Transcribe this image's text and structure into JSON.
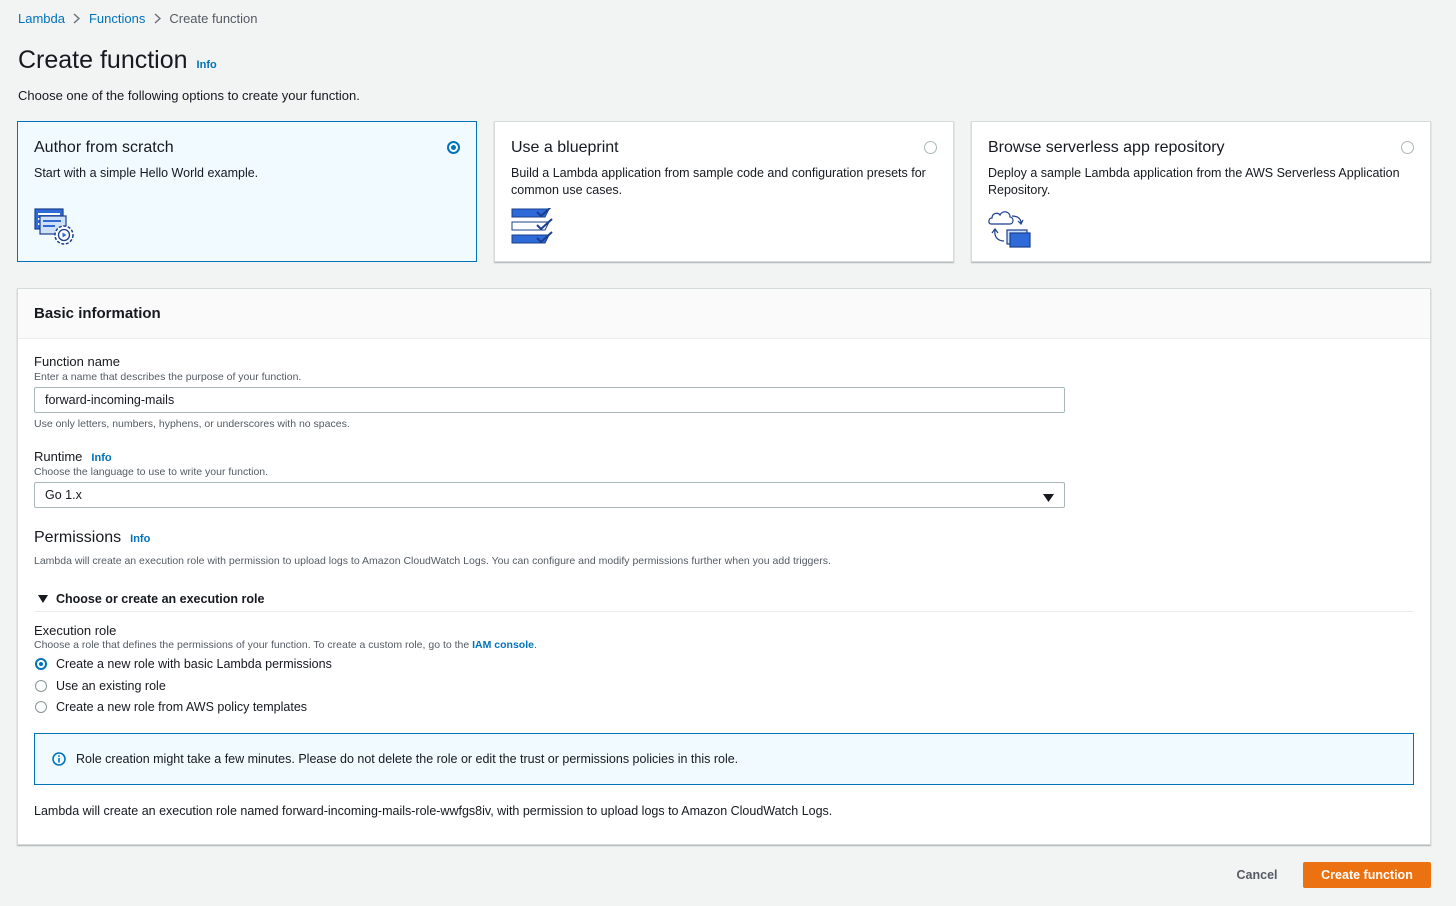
{
  "breadcrumb": {
    "items": [
      {
        "label": "Lambda"
      },
      {
        "label": "Functions"
      },
      {
        "label": "Create function"
      }
    ]
  },
  "header": {
    "title": "Create function",
    "info_label": "Info",
    "description": "Choose one of the following options to create your function."
  },
  "options": [
    {
      "title": "Author from scratch",
      "description": "Start with a simple Hello World example.",
      "selected": true
    },
    {
      "title": "Use a blueprint",
      "description": "Build a Lambda application from sample code and configuration presets for common use cases.",
      "selected": false
    },
    {
      "title": "Browse serverless app repository",
      "description": "Deploy a sample Lambda application from the AWS Serverless Application Repository.",
      "selected": false
    }
  ],
  "basic_info": {
    "title": "Basic information",
    "function_name": {
      "label": "Function name",
      "description": "Enter a name that describes the purpose of your function.",
      "value": "forward-incoming-mails",
      "constraint": "Use only letters, numbers, hyphens, or underscores with no spaces."
    },
    "runtime": {
      "label": "Runtime",
      "info_label": "Info",
      "description": "Choose the language to use to write your function.",
      "value": "Go 1.x"
    },
    "permissions": {
      "title": "Permissions",
      "info_label": "Info",
      "description": "Lambda will create an execution role with permission to upload logs to Amazon CloudWatch Logs. You can configure and modify permissions further when you add triggers.",
      "expander_label": "Choose or create an execution role",
      "execution_role": {
        "label": "Execution role",
        "description_prefix": "Choose a role that defines the permissions of your function. To create a custom role, go to the ",
        "description_link": "IAM console",
        "description_suffix": ".",
        "options": [
          {
            "label": "Create a new role with basic Lambda permissions",
            "selected": true
          },
          {
            "label": "Use an existing role",
            "selected": false
          },
          {
            "label": "Create a new role from AWS policy templates",
            "selected": false
          }
        ]
      },
      "alert": "Role creation might take a few minutes. Please do not delete the role or edit the trust or permissions policies in this role.",
      "summary": "Lambda will create an execution role named forward-incoming-mails-role-wwfgs8iv, with permission to upload logs to Amazon CloudWatch Logs."
    }
  },
  "footer": {
    "cancel_label": "Cancel",
    "create_label": "Create function"
  },
  "colors": {
    "link": "#0073bb",
    "primary_button": "#ec7211",
    "selected_tile_bg": "#f1faff",
    "background": "#f2f3f3"
  },
  "icons": [
    "chevron-right-icon",
    "author-from-scratch-icon",
    "blueprint-icon",
    "serverless-repo-icon",
    "caret-down-icon",
    "triangle-expanded-icon",
    "info-circle-icon"
  ]
}
